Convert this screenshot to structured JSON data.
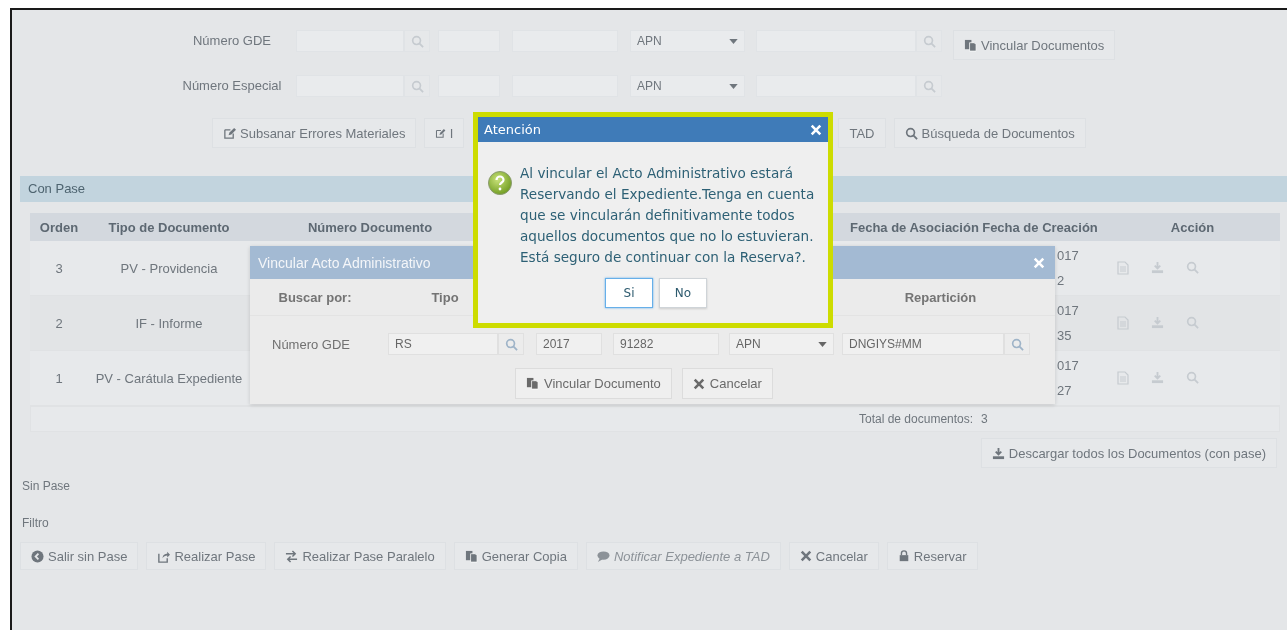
{
  "search_rows": [
    {
      "label": "Número GDE",
      "select_value": "APN",
      "action_button": "Vincular Documentos"
    },
    {
      "label": "Número Especial",
      "select_value": "APN"
    }
  ],
  "form_buttons": [
    {
      "label": "Subsanar Errores Materiales",
      "kind": "edit"
    },
    {
      "label": "I",
      "kind": "edit"
    },
    {
      "label": "TAD",
      "kind": "plain"
    },
    {
      "label": "Búsqueda de Documentos",
      "kind": "search"
    }
  ],
  "con_pase": {
    "title": "Con Pase",
    "columns": [
      "Orden",
      "Tipo de Documento",
      "Número Documento",
      "Fecha de Asociación",
      "Fecha de Creación",
      "Acción"
    ],
    "rows": [
      {
        "orden": "3",
        "tipo": "PV - Providencia",
        "fecha_creacion": [
          "017",
          "2"
        ]
      },
      {
        "orden": "2",
        "tipo": "IF - Informe",
        "fecha_creacion": [
          "017",
          "35"
        ]
      },
      {
        "orden": "1",
        "tipo": "PV - Carátula Expediente",
        "fecha_creacion": [
          "017",
          "27"
        ]
      }
    ],
    "total_label": "Total de documentos:",
    "total": "3",
    "download_button": "Descargar todos los Documentos (con pase)"
  },
  "sin_pase": "Sin Pase",
  "filtro": "Filtro",
  "footer_buttons": [
    {
      "label": "Salir sin Pase",
      "kind": "circle-arrow",
      "disabled": false
    },
    {
      "label": "Realizar Pase",
      "kind": "share",
      "disabled": false
    },
    {
      "label": "Realizar Pase Paralelo",
      "kind": "swap",
      "disabled": false
    },
    {
      "label": "Generar Copia",
      "kind": "copy",
      "disabled": false
    },
    {
      "label": "Notificar Expediente a TAD",
      "kind": "comment",
      "disabled": true
    },
    {
      "label": "Cancelar",
      "kind": "close",
      "disabled": false
    },
    {
      "label": "Reservar",
      "kind": "lock",
      "disabled": false
    }
  ],
  "vincular_modal": {
    "title": "Vincular Acto Administrativo",
    "columns": [
      "Buscar por:",
      "Tipo",
      "Repartición"
    ],
    "search_by": "Número GDE",
    "tipo": "RS",
    "anio": "2017",
    "numero": "91282",
    "ecosistema": "APN",
    "reparticion": "DNGIYS#MM",
    "buttons": [
      {
        "label": "Vincular Documento",
        "kind": "copy"
      },
      {
        "label": "Cancelar",
        "kind": "close"
      }
    ]
  },
  "alert": {
    "title": "Atención",
    "message": "Al vincular el Acto Administrativo estará Reservando el Expediente.Tenga en cuenta que se vincularán definitivamente todos aquellos documentos que no lo estuvieran. Está seguro de continuar con la Reserva?.",
    "buttons": [
      {
        "label": "Si",
        "selected": true
      },
      {
        "label": "No",
        "selected": false
      }
    ]
  }
}
